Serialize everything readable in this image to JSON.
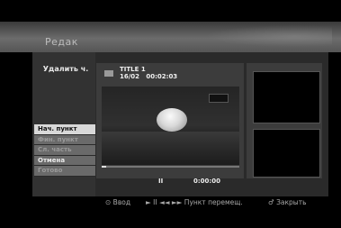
{
  "screen": {
    "title": "Редак"
  },
  "menu": {
    "heading": "Удалить ч.",
    "items": [
      {
        "label": "Нач. пункт",
        "state": "active"
      },
      {
        "label": "Фин. пункт",
        "state": "disabled"
      },
      {
        "label": "Сл. часть",
        "state": "disabled"
      },
      {
        "label": "Отмена",
        "state": "normal"
      },
      {
        "label": "Готово",
        "state": "disabled"
      }
    ]
  },
  "video": {
    "title": "TITLE 1",
    "date": "16/02",
    "duration": "00:02:03",
    "playback_icon": "pause-icon",
    "pause_glyph": "II",
    "position": "0:00:00",
    "progress_fraction": 0.03
  },
  "hints": {
    "enter": "⊙ Ввод",
    "nav": "► II ◄◄ ►► Пункт перемещ.",
    "close": "♂ Закрыть"
  },
  "colors": {
    "active_item_bg": "#d8d8d8",
    "item_bg": "#6a6a6a",
    "panel_bg": "#2a2a2a"
  }
}
